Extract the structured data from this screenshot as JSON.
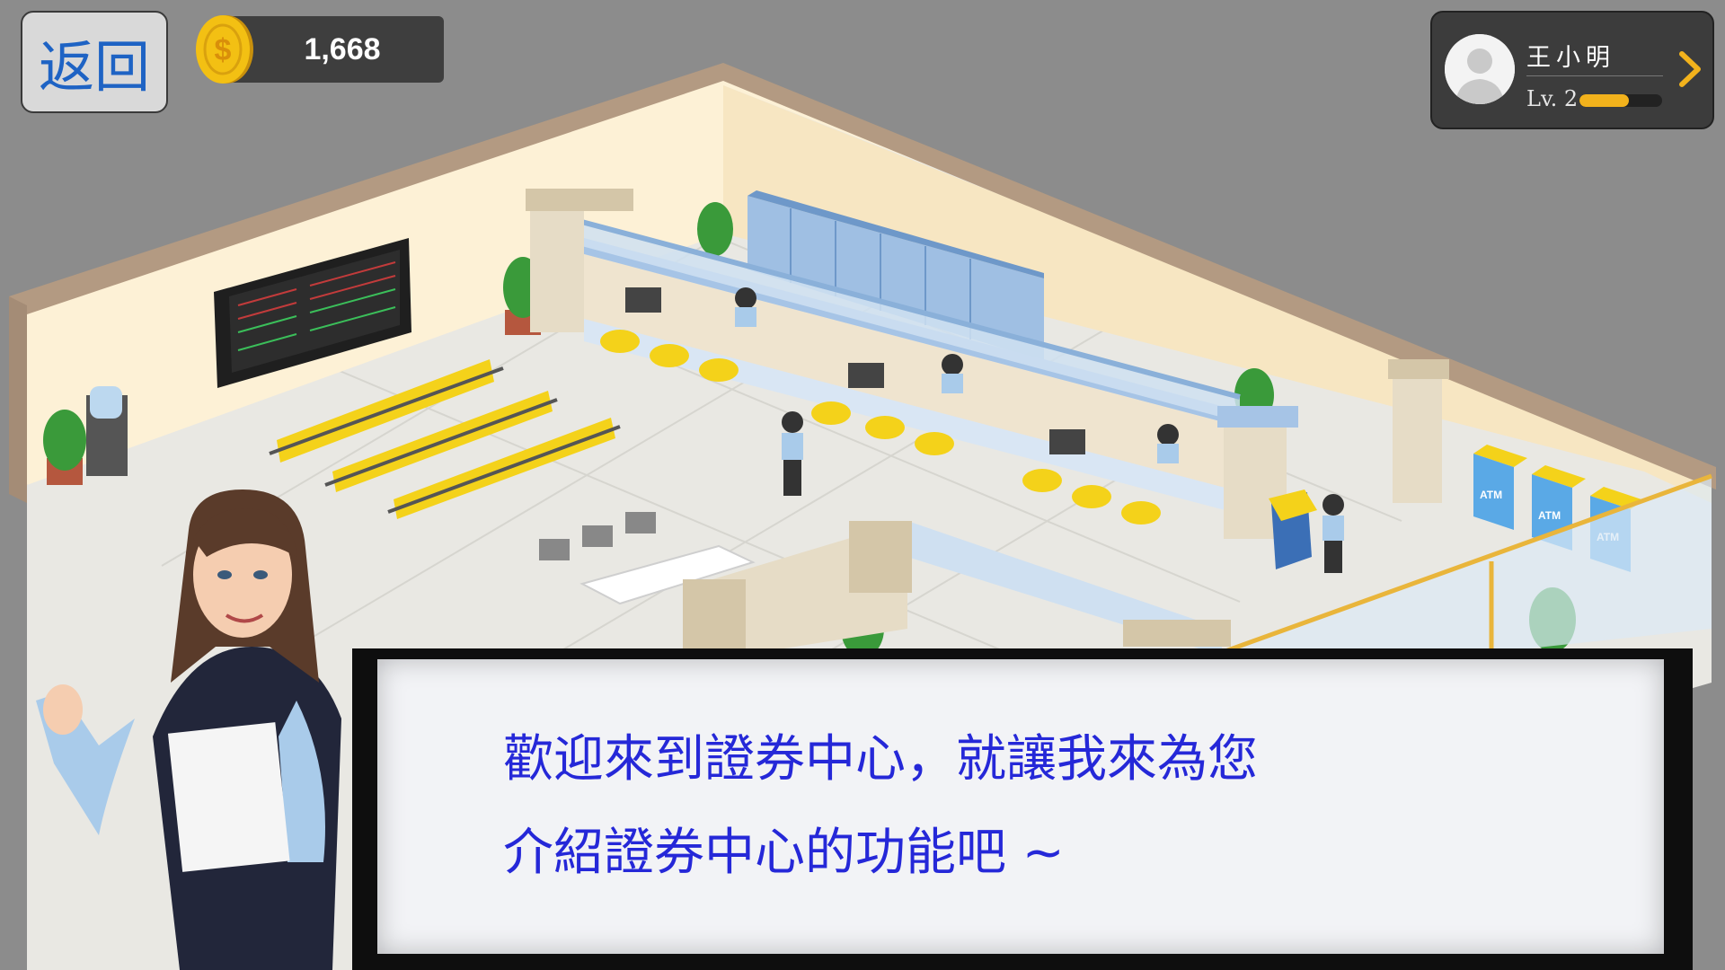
{
  "hud": {
    "back_label": "返回",
    "coins": "1,668",
    "player": {
      "name": "王小明",
      "level": "Lv. 2",
      "xp_fraction": 0.6
    }
  },
  "dialog": {
    "line1": "歡迎來到證券中心，就讓我來為您",
    "line2": "介紹證券中心的功能吧 ~"
  },
  "scene": {
    "atm_label": "ATM",
    "icons": [
      "coin-icon",
      "avatar-icon",
      "chevron-right-icon"
    ]
  },
  "colors": {
    "text_blue": "#2528d8",
    "back_blue": "#1e63c4",
    "coin_gold": "#f3c013",
    "xp_gold": "#f2b21c",
    "chair_yellow": "#f4d21a"
  }
}
